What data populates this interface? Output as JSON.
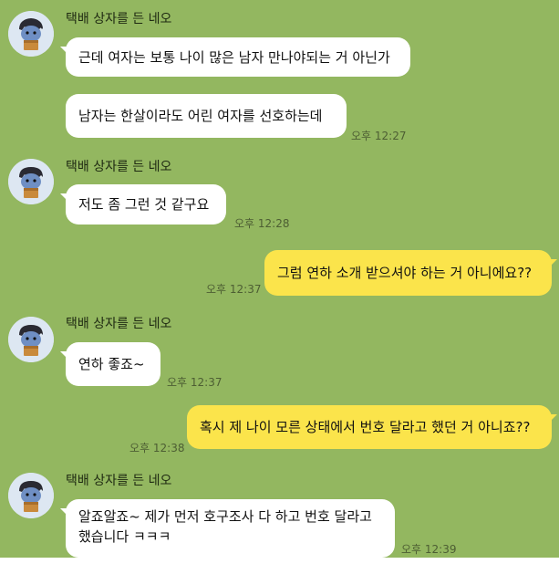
{
  "sender_name": "택배 상자를 든 네오",
  "colors": {
    "background": "#93b760",
    "incoming_bubble": "#ffffff",
    "outgoing_bubble": "#fbe44b"
  },
  "messages": [
    {
      "direction": "in",
      "text": "근데 여자는 보통 나이 많은 남자 만나야되는 거 아닌가"
    },
    {
      "direction": "in",
      "text": "남자는 한살이라도 어린 여자를 선호하는데",
      "time": "오후 12:27"
    },
    {
      "direction": "in",
      "text": "저도 좀 그런 것 같구요",
      "time": "오후 12:28"
    },
    {
      "direction": "out",
      "text": "그럼 연하 소개 받으셔야 하는 거 아니에요??",
      "time": "오후 12:37"
    },
    {
      "direction": "in",
      "text": "연하 좋죠~",
      "time": "오후 12:37"
    },
    {
      "direction": "out",
      "text": "혹시 제 나이 모른 상태에서 번호 달라고 했던 거 아니죠??",
      "time": "오후 12:38"
    },
    {
      "direction": "in",
      "text": "알죠알죠~ 제가 먼저 호구조사 다 하고 번호 달라고 했습니다 ㅋㅋㅋ",
      "time": "오후 12:39"
    }
  ]
}
